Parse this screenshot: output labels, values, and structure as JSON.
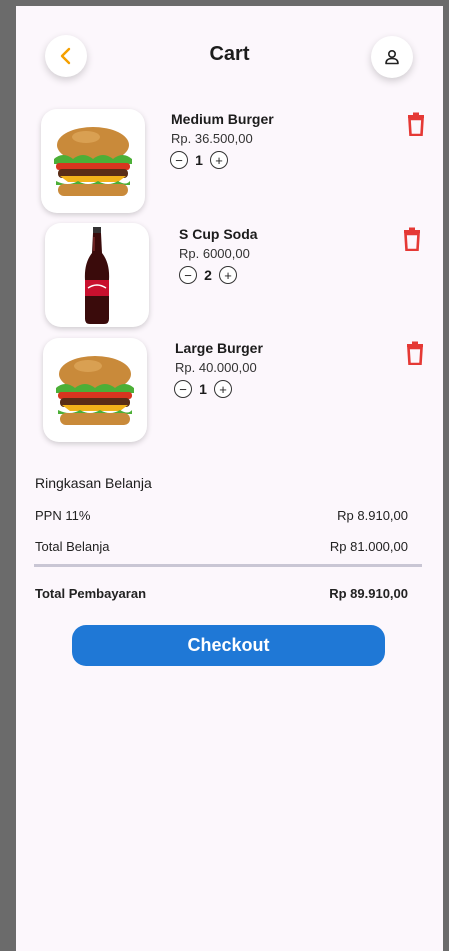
{
  "header": {
    "title": "Cart",
    "back_icon": "chevron-left-icon",
    "profile_icon": "person-icon",
    "accent": "#f5a000"
  },
  "items": [
    {
      "name": "Medium Burger",
      "price": "Rp. 36.500,00",
      "qty": "1",
      "image": "burger"
    },
    {
      "name": "S Cup Soda",
      "price": "Rp. 6000,00",
      "qty": "2",
      "image": "soda-bottle"
    },
    {
      "name": "Large Burger",
      "price": "Rp. 40.000,00",
      "qty": "1",
      "image": "burger"
    }
  ],
  "stepper": {
    "minus": "−",
    "plus": "+"
  },
  "delete_color": "#e53935",
  "summary": {
    "title": "Ringkasan Belanja",
    "tax_label": "PPN 11%",
    "tax_value": "Rp 8.910,00",
    "subtotal_label": "Total Belanja",
    "subtotal_value": "Rp 81.000,00",
    "total_label": "Total Pembayaran",
    "total_value": "Rp 89.910,00"
  },
  "checkout": {
    "label": "Checkout",
    "color": "#1f78d6"
  }
}
